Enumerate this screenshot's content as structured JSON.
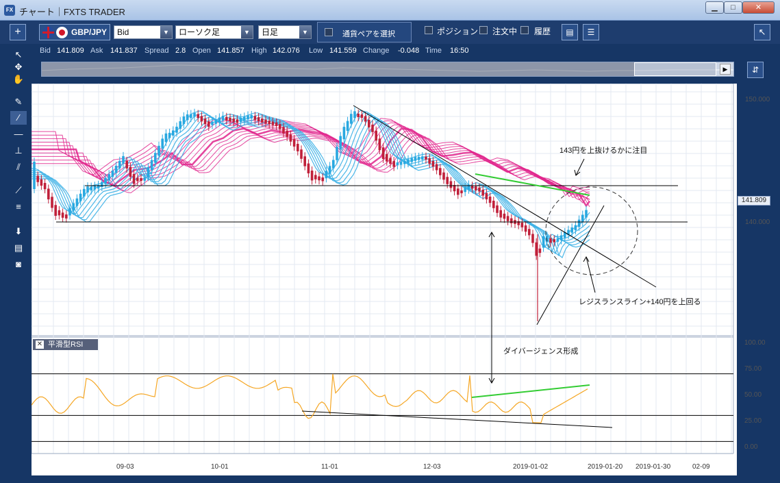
{
  "window": {
    "icon": "FX",
    "title": "チャート｜FXTS TRADER",
    "buttons": [
      "minimize-icon",
      "maximize-icon",
      "close-icon"
    ]
  },
  "toolbar": {
    "add_label": "+",
    "symbol": "GBP/JPY",
    "price_type": "Bid",
    "chart_type": "ローソク足",
    "timeframe": "日足",
    "pair_select": "通貨ペアを選択",
    "checkbox_position": "ポジション",
    "checkbox_orders": "注文中",
    "checkbox_history": "履歴",
    "collapse_icon": "arrow-up-left-icon"
  },
  "quote": {
    "bid_label": "Bid",
    "bid": "141.809",
    "ask_label": "Ask",
    "ask": "141.837",
    "spread_label": "Spread",
    "spread": "2.8",
    "open_label": "Open",
    "open": "141.857",
    "high_label": "High",
    "high": "142.076",
    "low_label": "Low",
    "low": "141.559",
    "change_label": "Change",
    "change": "-0.048",
    "time_label": "Time",
    "time": "16:50"
  },
  "annotations": {
    "top_note": "143円を上抜けるかに注目",
    "resistance_note": "レジスランスライン+140円を上回る",
    "divergence_note": "ダイバージェンス形成"
  },
  "rsi_panel": {
    "title": "平滑型RSI"
  },
  "price_axis": [
    "150.000",
    "140.000"
  ],
  "current_price": "141.809",
  "rsi_axis": [
    "100.00",
    "75.00",
    "50.00",
    "25.00",
    "0.00"
  ],
  "date_axis": [
    "09-03",
    "10-01",
    "11-01",
    "12-03",
    "2019-01-02",
    "2019-01-20",
    "2019-01-30",
    "02-09"
  ],
  "colors": {
    "candle_up": "#29a8e0",
    "candle_down": "#c0203a",
    "ribbon_pink": "#e0248c",
    "ribbon_blue": "#3ab0e6",
    "rsi_line": "#f5a623",
    "green_line": "#33cc33"
  }
}
